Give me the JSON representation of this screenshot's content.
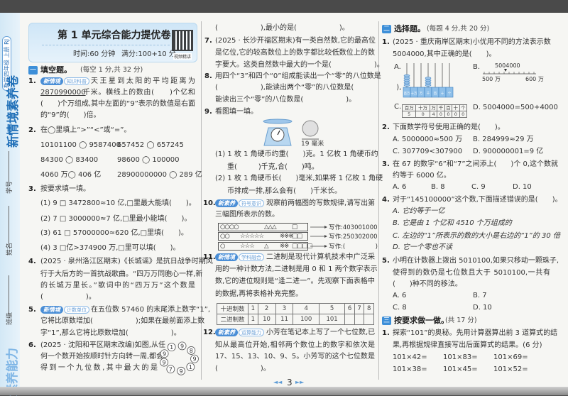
{
  "sidebar": {
    "book": "数学四年级 上册 RJ",
    "series": "新情境素养卷",
    "student_id": "学号",
    "name": "姓名",
    "class": "班级",
    "brand": "素养能力"
  },
  "header": {
    "title": "第 1 单元综合能力提优卷",
    "time": "时间:60 分钟",
    "full_score": "满分:100+10 分",
    "qr_label": "视频精讲"
  },
  "section1": {
    "badge": "一",
    "title": "填空题。",
    "score": "(每空 1 分,共 32 分)"
  },
  "q1": {
    "num": "1.",
    "tag": "新情境",
    "subtag": "知识科普",
    "lines": [
      "天王星到太阳的平均距离为",
      "2870990000",
      "千米。横线上的数由(　　)个亿和",
      "(　　)个万组成,其中左面的“9”表示的数值是右面",
      "的“9”的(　　)倍。"
    ]
  },
  "q2": {
    "num": "2.",
    "text": "在◯里填上“>”“<”或“=”。",
    "items": [
      "10101100 ◯ 9587400",
      "657452 ◯ 657245",
      "84300 ◯ 83400",
      "98600 ◯ 100000",
      "4060 万◯ 406 亿",
      "28900000000 ◯ 289 亿"
    ]
  },
  "q3": {
    "num": "3.",
    "text": "按要求填一填。",
    "items": [
      "(1) 9 □ 3472800≈10 亿,□里最大能填(　　)。",
      "(2) 7 □ 3000000≈7 亿,□里最小能填(　　)。",
      "(3) 61 □ 57000000≈620 亿,□里填(　　)。",
      "(4) 3 □亿>374900 万,□里可以填(　　)。"
    ]
  },
  "q4": {
    "num": "4.",
    "lines": [
      "(2025 · 泉州洛江区期末)《长城谣》是抗日战争时期风",
      "行于大后方的一首抗战歌曲。“四万万同胞心一样,新",
      "的长城万里长。”歌词中的“四万万”这个数是",
      "(　　　　　　)。"
    ]
  },
  "q5": {
    "num": "5.",
    "tag": "新情境",
    "subtag": "计数单位",
    "lines": [
      "在五位数 57460 的末尾添上数字“1”,",
      "它将比原数增加(　　　　　　);如果在最前面添上数",
      "字“1”,那么它将比原数增加(　　　　　　)。"
    ]
  },
  "q6": {
    "num": "6.",
    "lines": [
      "(2025 · 沈阳和平区期末改编)如图,从任",
      "何一个数开始按顺时针方向转一周,都会",
      "得到一个九位数,其中最大的是",
      "(　　　　　　),最小的是(　　　　　　)。"
    ],
    "ring": [
      "1",
      "9",
      "8",
      "9",
      "1",
      "9",
      "7",
      "9",
      "9"
    ]
  },
  "q7": {
    "num": "7.",
    "lines": [
      "(2025 · 长沙开福区期末)有一类自然数,它的最高位",
      "是亿位,它的较高数位上的数字都比较低数位上的数",
      "字要大。这类自然数中最大的一个是(　　　　　　)。"
    ]
  },
  "q8": {
    "num": "8.",
    "lines": [
      "用四个“3”和四个“0”组成能读出一个“零”的八位数是",
      "(　　　　　　),能读出两个“零”的八位数是(　　　　　　),",
      "能读出三个“零”的八位数是(　　　　　　)。"
    ]
  },
  "q9": {
    "num": "9.",
    "text": "看图填一填。",
    "coin_face": "1",
    "coin_label": "19 毫米",
    "lines": [
      "(1) 1 枚 1 角硬币约重(　　)克。1 亿枚 1 角硬币约",
      "重(　　　)千克,合(　　)吨。",
      "(2) 1 枚 1 角硬币长(　　)毫米,如果将 1 亿枚 1 角硬",
      "币排成一排,那么会有(　　)千米长。"
    ]
  },
  "q10": {
    "num": "10.",
    "tag": "新素养",
    "subtag": "符号意识",
    "lines": [
      "观察前两幅图的写数规律,请写出第",
      "三幅图所表示的数。"
    ],
    "rows": [
      {
        "groups": [
          "○○○○",
          "",
          "△△△",
          "",
          "□"
        ],
        "answer": "写作:403001000"
      },
      {
        "groups": [
          "○○",
          "☆☆☆☆☆",
          "",
          "※※※",
          "□□"
        ],
        "answer": "写作:250302000"
      },
      {
        "groups": [
          "○",
          "☆☆☆",
          "△",
          "※※",
          "□□□□"
        ],
        "answer": "写作:(　　　　　)"
      }
    ]
  },
  "q11": {
    "num": "11.",
    "tag": "新情境",
    "subtag": "学科融合",
    "lines": [
      "二进制是现代计算机技术中广泛采",
      "用的一种计数方法,二进制是用 0 和 1 两个数字表示",
      "数,它的进位规则是“逢二进一”。先观察下面表格中",
      "的数据,再将表格补充完整。"
    ],
    "table": {
      "row1_label": "十进制数",
      "row1": [
        "1",
        "2",
        "3",
        "4",
        "5",
        "6",
        "7",
        "8"
      ],
      "row2_label": "二进制数",
      "row2": [
        "1",
        "10",
        "11",
        "100",
        "101",
        "",
        "",
        ""
      ]
    }
  },
  "q12": {
    "num": "12.",
    "tag": "新素养",
    "subtag": "运算能力",
    "lines": [
      "小芳在笔记本上写了一个七位数,已",
      "知从最高位开始,相邻两个数位上的数字和依次是",
      "17、15、13、10、9、5。小芳写的这个七位数是",
      "(　　　　　　)。"
    ]
  },
  "section2": {
    "badge": "二",
    "title": "选择题。",
    "score": "(每题 4 分,共 20 分)"
  },
  "c1": {
    "num": "1.",
    "lines": [
      "(2025 · 重庆南岸区期末)小优用不同的方法表示数",
      "5004000,其中正确的是(　　)。"
    ],
    "optA": "A.",
    "optB": "B.",
    "optC": "C.",
    "optD": "D. 5004000=500+4000",
    "abacus": {
      "places": [
        "百万",
        "十万",
        "万",
        "千",
        "百",
        "十",
        "个"
      ],
      "beads": [
        5,
        0,
        0,
        4,
        0,
        0,
        0
      ]
    },
    "numline": {
      "marker": "5004000",
      "left": "500 万",
      "right": "600 万"
    },
    "table": {
      "places": [
        "百万",
        "十万",
        "万",
        "千",
        "百",
        "十",
        "个"
      ],
      "digits": [
        "5",
        "0",
        "4",
        "0",
        "0",
        "0",
        "0"
      ]
    }
  },
  "c2": {
    "num": "2.",
    "text": "下面数学符号使用正确的是(　　)。",
    "options": [
      "A. 5000000≈500 万",
      "B. 284999≈29 万",
      "C. 307709<307900",
      "D. 900000001=9 亿"
    ]
  },
  "c3": {
    "num": "3.",
    "lines": [
      "在 67 的数字“6”和“7”之间添上(　　)个 0,这个数就",
      "约等于 6000 亿。"
    ],
    "options": [
      "A. 6",
      "B. 8",
      "C. 9",
      "D. 10"
    ]
  },
  "c4": {
    "num": "4.",
    "text": "对于“145100000”这个数,下面描述错误的是(　　)。",
    "options": [
      "A. 它约等于一亿",
      "B. 它是由 1 个亿和 4510 个万组成的",
      "C. 左边的“1”所表示的数的大小是右边的“1”的 30 倍",
      "D. 它一个零也不读"
    ]
  },
  "c5": {
    "num": "5.",
    "lines": [
      "小明在计数器上拨出 5010100,如果只移动一颗珠子,",
      "使得到的数仍是七位数且大于 5010100,一共有",
      "(　　)种不同的移法。"
    ],
    "options": [
      "A. 6",
      "B. 7",
      "C. 8",
      "D. 10"
    ]
  },
  "section3": {
    "badge": "三",
    "title": "按要求做一做。",
    "score": "(共 17 分)"
  },
  "d1": {
    "num": "1.",
    "lines": [
      "探索“101”的奥秘。先用计算器算出前 3 道算式的结",
      "果,再根据规律直接写出后面算式的结果。(6 分)"
    ],
    "calcs": [
      "101×42=",
      "101×83=",
      "101×69=",
      "101×38=",
      "101×45=",
      "101×52="
    ]
  },
  "footer": {
    "prev": "◄◄",
    "page": "3",
    "next": "►►"
  },
  "colors": {
    "accent": "#3d8fd8",
    "header_bg": "#d8ecf8"
  }
}
